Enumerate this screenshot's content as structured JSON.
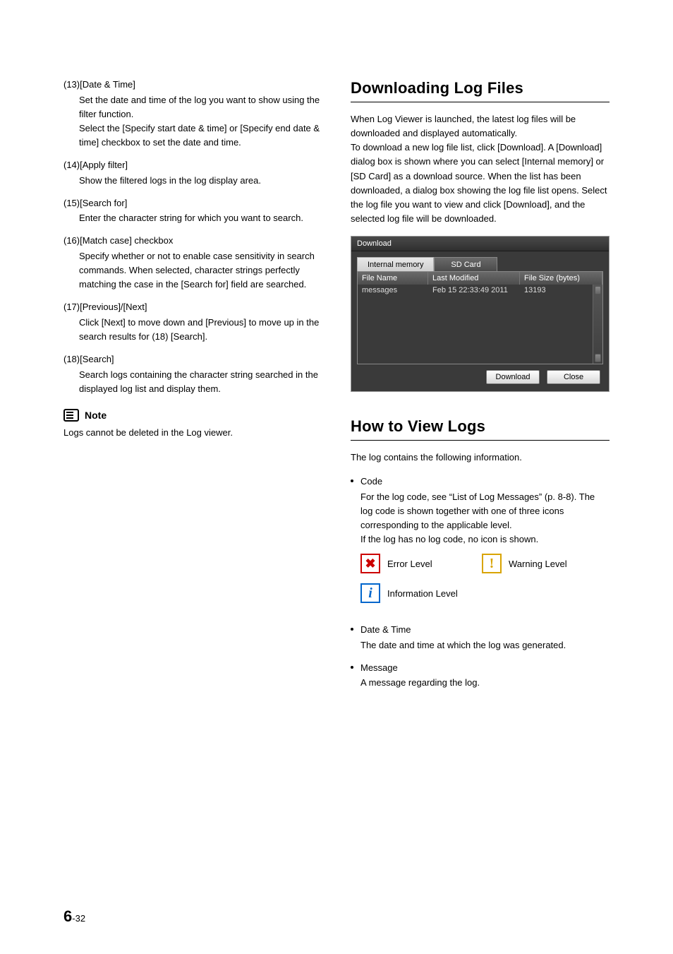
{
  "left": {
    "items": [
      {
        "num": "(13)",
        "title": "[Date & Time]",
        "desc": "Set the date and time of the log you want to show using the filter function.\nSelect the [Specify start date & time] or [Specify end date & time] checkbox to set the date and time."
      },
      {
        "num": "(14)",
        "title": "[Apply filter]",
        "desc": "Show the filtered logs in the log display area."
      },
      {
        "num": "(15)",
        "title": "[Search for]",
        "desc": "Enter the character string for which you want to search."
      },
      {
        "num": "(16)",
        "title": "[Match case] checkbox",
        "desc": "Specify whether or not to enable case sensitivity in search commands. When selected, character strings perfectly matching the case in the [Search for] field are searched."
      },
      {
        "num": "(17)",
        "title": "[Previous]/[Next]",
        "desc": "Click [Next] to move down and [Previous] to move up in the search results for (18) [Search]."
      },
      {
        "num": "(18)",
        "title": "[Search]",
        "desc": "Search logs containing the character string searched in the displayed log list and display them."
      }
    ],
    "note_label": "Note",
    "note_text": "Logs cannot be deleted in the Log viewer."
  },
  "right": {
    "section1_title": "Downloading Log Files",
    "section1_para": "When Log Viewer is launched, the latest log files will be downloaded and displayed automatically.\nTo download a new log file list, click [Download]. A [Download] dialog box is shown where you can select [Internal memory] or [SD Card] as a download source. When the list has been downloaded, a dialog box showing the log file list opens. Select the log file you want to view and click [Download], and the selected log file will be downloaded.",
    "dialog": {
      "title": "Download",
      "tabs": {
        "active": "Internal memory",
        "other": "SD Card"
      },
      "headers": {
        "fn": "File Name",
        "lm": "Last Modified",
        "fs": "File Size (bytes)"
      },
      "row": {
        "fn": "messages",
        "lm": "Feb 15 22:33:49 2011",
        "fs": "13193"
      },
      "buttons": {
        "download": "Download",
        "close": "Close"
      }
    },
    "section2_title": "How to View Logs",
    "section2_para": "The log contains the following information.",
    "bullets": [
      {
        "title": "Code",
        "desc": "For the log code, see “List of Log Messages” (p. 8-8). The log code is shown together with one of three icons corresponding to the applicable level.\nIf the log has no log code, no icon is shown."
      },
      {
        "title": "Date & Time",
        "desc": "The date and time at which the log was generated."
      },
      {
        "title": "Message",
        "desc": "A message regarding the log."
      }
    ],
    "legend": {
      "error": "Error Level",
      "warning": "Warning Level",
      "info": "Information Level"
    }
  },
  "page_number": {
    "chapter": "6",
    "sep": "-",
    "page": "32"
  }
}
